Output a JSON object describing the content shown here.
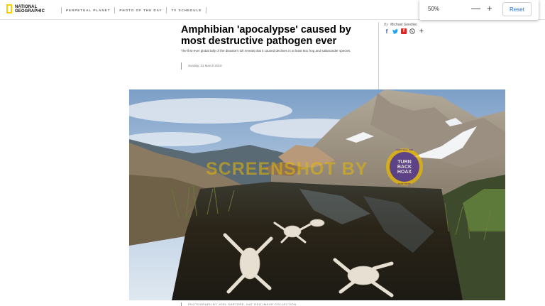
{
  "nav": {
    "logo_line1": "NATIONAL",
    "logo_line2": "GEOGRAPHIC",
    "items": [
      {
        "label": "PERPETUAL PLANET"
      },
      {
        "label": "PHOTO OF THE DAY"
      },
      {
        "label": "TV SCHEDULE"
      }
    ]
  },
  "zoom": {
    "value": "50%",
    "minus": "—",
    "plus": "+",
    "reset_label": "Reset"
  },
  "article": {
    "headline": "Amphibian 'apocalypse' caused by most destructive pathogen ever",
    "dek": "The first-ever global tally of the disease's toll reveals that it caused declines in at least 501 frog and salamander species.",
    "date": "Sunday, 31 March 2019",
    "byline_prefix": "By",
    "author": "Michael Greshko",
    "caption": "PHOTOGRAPH BY JOEL SARTORE, NAT GEO IMAGE COLLECTION"
  },
  "share": {
    "icons": [
      "facebook-icon",
      "twitter-icon",
      "flipboard-icon",
      "whatsapp-icon",
      "more-share-icon"
    ]
  },
  "watermark": {
    "text": "SCREENSHOT BY",
    "badge_line1": "TURN",
    "badge_line2": "BACK",
    "badge_line3": "HOAX",
    "badge_ring_top": "DON'T FALL FOR",
    "badge_ring_bottom": "FAKE STUFF"
  },
  "colors": {
    "logo_yellow": "#ffce00",
    "reset_blue": "#1a73e8",
    "watermark_gold": "#e8b800",
    "badge_purple": "#4b2a8a"
  }
}
